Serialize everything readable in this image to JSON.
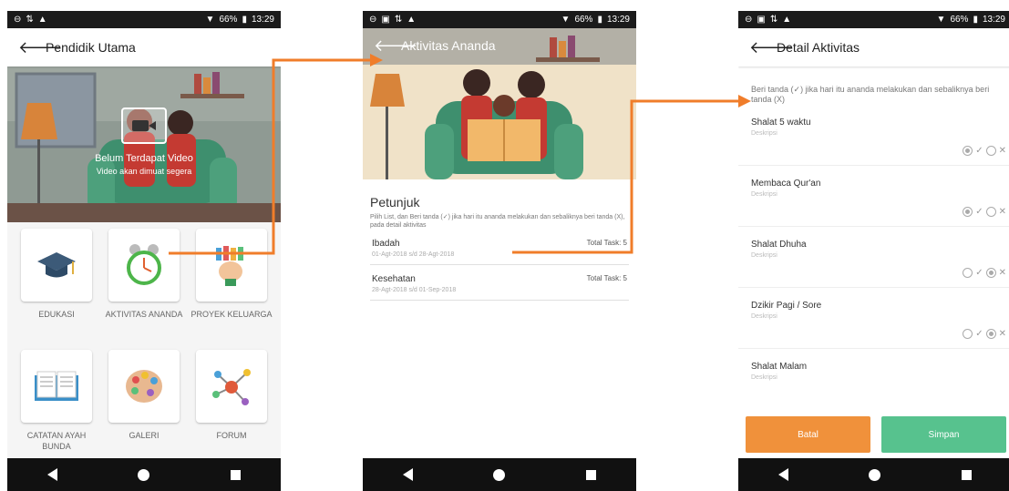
{
  "status": {
    "battery": "66%",
    "time": "13:29"
  },
  "screen1": {
    "title": "Pendidik Utama",
    "video_title": "Belum Terdapat Video",
    "video_subtitle": "Video akan dimuat segera",
    "menu": [
      {
        "label": "EDUKASI",
        "icon": "graduation-cap-icon"
      },
      {
        "label": "AKTIVITAS ANANDA",
        "icon": "alarm-clock-icon"
      },
      {
        "label": "PROYEK KELUARGA",
        "icon": "paint-brush-hand-icon"
      },
      {
        "label": "CATATAN AYAH BUNDA",
        "icon": "book-icon"
      },
      {
        "label": "GALERI",
        "icon": "palette-icon"
      },
      {
        "label": "FORUM",
        "icon": "network-icon"
      }
    ]
  },
  "screen2": {
    "title": "Aktivitas Ananda",
    "petunjuk_title": "Petunjuk",
    "petunjuk_text": "Pilih List, dan Beri tanda (✓) jika hari itu ananda melakukan dan sebaliknya beri tanda (X), pada detail aktivitas",
    "activities": [
      {
        "name": "Ibadah",
        "task": "Total Task: 5",
        "date": "01-Agt-2018 s/d 28-Agt-2018"
      },
      {
        "name": "Kesehatan",
        "task": "Total Task: 5",
        "date": "28-Agt-2018 s/d 01-Sep-2018"
      }
    ]
  },
  "screen3": {
    "title": "Detail Aktivitas",
    "instruction": "Beri tanda (✓) jika hari itu ananda melakukan dan sebaliknya beri tanda (X)",
    "items": [
      {
        "name": "Shalat 5 waktu",
        "desc": "Deskripsi",
        "selected": "check"
      },
      {
        "name": "Membaca Qur'an",
        "desc": "Deskripsi",
        "selected": "check"
      },
      {
        "name": "Shalat Dhuha",
        "desc": "Deskripsi",
        "selected": "cross"
      },
      {
        "name": "Dzikir Pagi / Sore",
        "desc": "Deskripsi",
        "selected": "cross"
      },
      {
        "name": "Shalat Malam",
        "desc": "Deskripsi",
        "selected": "none"
      }
    ],
    "cancel_label": "Batal",
    "save_label": "Simpan"
  },
  "colors": {
    "accent_orange": "#f0913b",
    "accent_green": "#57c28e",
    "connector": "#f07d2a"
  }
}
